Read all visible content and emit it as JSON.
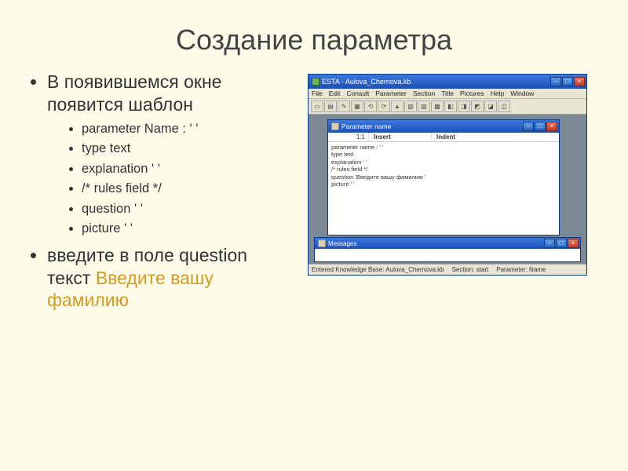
{
  "slide": {
    "title": "Создание параметра",
    "bullets_top": [
      "В появившемся окне появится шаблон"
    ],
    "sub": [
      "parameter Name : ' '",
      "type text",
      "explanation ' '",
      "/* rules field */",
      "question ' '",
      "picture ' '"
    ],
    "bullet2_pre": "введите в поле question текст ",
    "bullet2_orange": "Введите вашу фамилию"
  },
  "outer": {
    "title": "ESTA - Aulova_Chernova.kb",
    "menu": [
      "File",
      "Edit",
      "Consult",
      "Parameter",
      "Section",
      "Title",
      "Pictures",
      "Help",
      "Window"
    ],
    "status": {
      "kb": "Entered Knowledge Base: Aulova_Chernova.kb",
      "section": "Section: start",
      "param": "Parameter: Name"
    }
  },
  "editor": {
    "title": "Parameter name",
    "head": {
      "pos": "1:1",
      "c2": "Insert",
      "c3": "Indent"
    },
    "lines": [
      "parameter name : ' '",
      "type text",
      "explanation ' '",
      "/* rules field */",
      "question 'Введите вашу фамилию '",
      "picture ' '"
    ]
  },
  "messages": {
    "title": "Messages"
  }
}
